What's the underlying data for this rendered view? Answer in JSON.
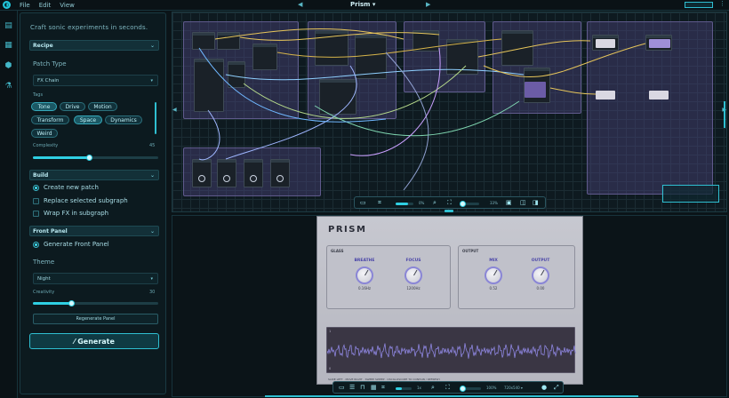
{
  "app": {
    "menu": [
      "File",
      "Edit",
      "View"
    ],
    "title": "Prism"
  },
  "sidebar": {
    "tagline": "Craft sonic experiments in seconds.",
    "recipe": {
      "header": "Recipe",
      "patch_type_label": "Patch Type",
      "patch_type_value": "FX Chain",
      "tags_label": "Tags",
      "tags": [
        {
          "label": "Tone",
          "selected": true
        },
        {
          "label": "Drive",
          "selected": false
        },
        {
          "label": "Motion",
          "selected": false
        },
        {
          "label": "Transform",
          "selected": false
        },
        {
          "label": "Space",
          "selected": true
        },
        {
          "label": "Dynamics",
          "selected": false
        },
        {
          "label": "Weird",
          "selected": false
        }
      ],
      "complexity_label": "Complexity",
      "complexity_value": "45"
    },
    "build": {
      "header": "Build",
      "options": [
        {
          "label": "Create new patch",
          "type": "radio",
          "checked": true
        },
        {
          "label": "Replace selected subgraph",
          "type": "checkbox",
          "checked": false
        },
        {
          "label": "Wrap FX in subgraph",
          "type": "checkbox",
          "checked": false
        }
      ]
    },
    "front_panel": {
      "header": "Front Panel",
      "generate_label": "Generate Front Panel",
      "theme_label": "Theme",
      "theme_value": "Night",
      "creativity_label": "Creativity",
      "creativity_value": "30",
      "regenerate_label": "Regenerate Panel"
    },
    "generate_label": "⁄ Generate"
  },
  "graph_toolbar": {
    "zoom_text": "0%",
    "zoom2_text": "33%"
  },
  "preview": {
    "panel_title": "PRISM",
    "groups": [
      {
        "title": "GLASS",
        "knobs": [
          {
            "label": "BREATHE",
            "value": "0.16Hz"
          },
          {
            "label": "FOCUS",
            "value": "1200Hz"
          }
        ]
      },
      {
        "title": "OUTPUT",
        "knobs": [
          {
            "label": "MIX",
            "value": "0.52"
          },
          {
            "label": "OUTPUT",
            "value": "0.00"
          }
        ]
      }
    ],
    "scope_top": "1",
    "scope_bottom": "0",
    "footer": "SLIDE LEFT · MOVE RIGHT · SWEEP SWEEP · OSCILLOSCOPE TO CONTAIN / REFRESH",
    "toolbar": {
      "zoom_text": "1x",
      "zoom2_text": "100%",
      "resolution": "720x540"
    }
  },
  "colors": {
    "accent": "#2fd0e3",
    "group": "#5f5a8c",
    "panel": "#c0c1ca"
  }
}
